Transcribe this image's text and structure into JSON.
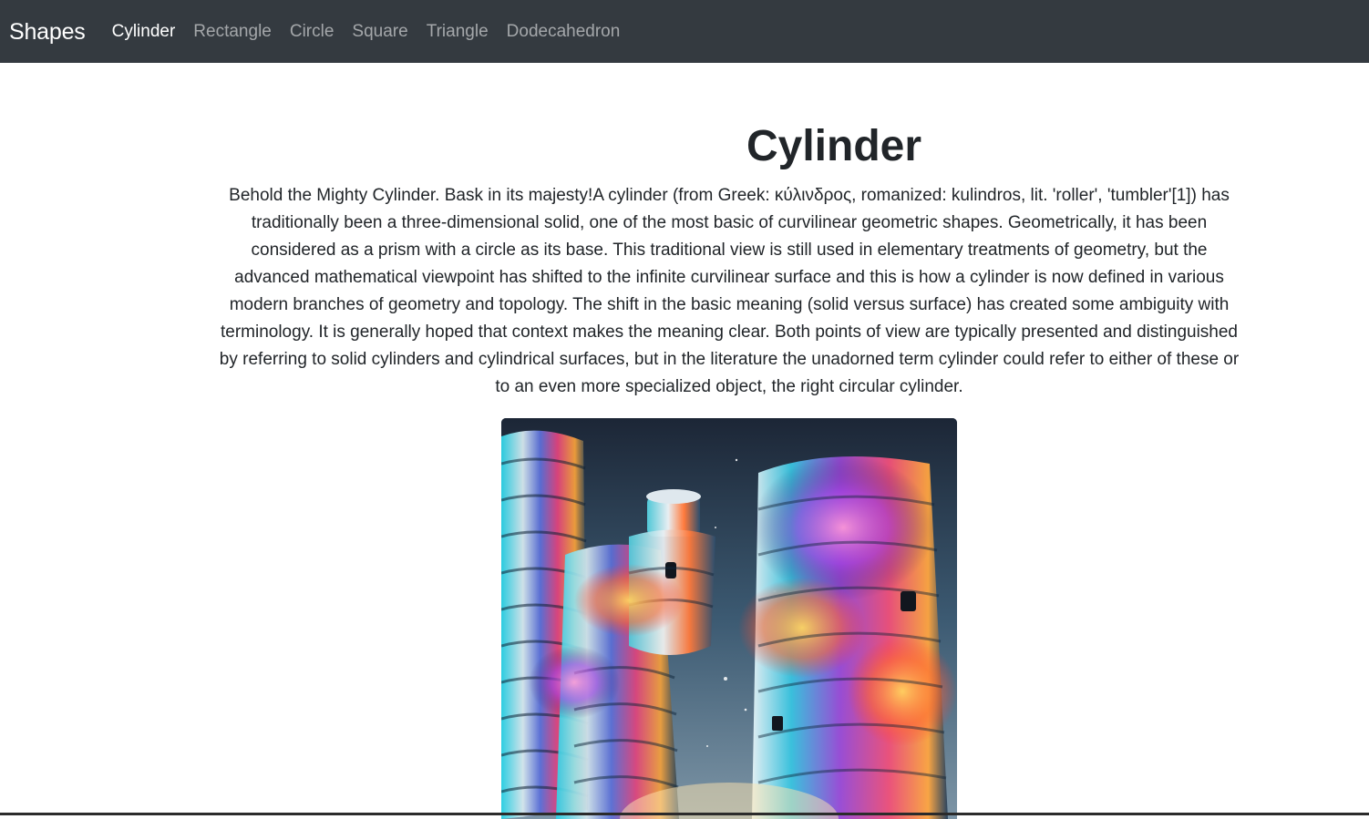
{
  "navbar": {
    "brand": "Shapes",
    "items": [
      {
        "label": "Cylinder",
        "active": true
      },
      {
        "label": "Rectangle",
        "active": false
      },
      {
        "label": "Circle",
        "active": false
      },
      {
        "label": "Square",
        "active": false
      },
      {
        "label": "Triangle",
        "active": false
      },
      {
        "label": "Dodecahedron",
        "active": false
      }
    ]
  },
  "content": {
    "title": "Cylinder",
    "description": "Behold the Mighty Cylinder. Bask in its majesty!A cylinder (from Greek: κύλινδρος, romanized: kulindros, lit. 'roller', 'tumbler'[1]) has traditionally been a three-dimensional solid, one of the most basic of curvilinear geometric shapes. Geometrically, it has been considered as a prism with a circle as its base. This traditional view is still used in elementary treatments of geometry, but the advanced mathematical viewpoint has shifted to the infinite curvilinear surface and this is how a cylinder is now defined in various modern branches of geometry and topology. The shift in the basic meaning (solid versus surface) has created some ambiguity with terminology. It is generally hoped that context makes the meaning clear. Both points of view are typically presented and distinguished by referring to solid cylinders and cylindrical surfaces, but in the literature the unadorned term cylinder could refer to either of these or to an even more specialized object, the right circular cylinder."
  },
  "colors": {
    "navbar_bg": "#343a40",
    "nav_active": "#ffffff",
    "nav_inactive": "rgba(255,255,255,0.55)",
    "text": "#212529"
  }
}
